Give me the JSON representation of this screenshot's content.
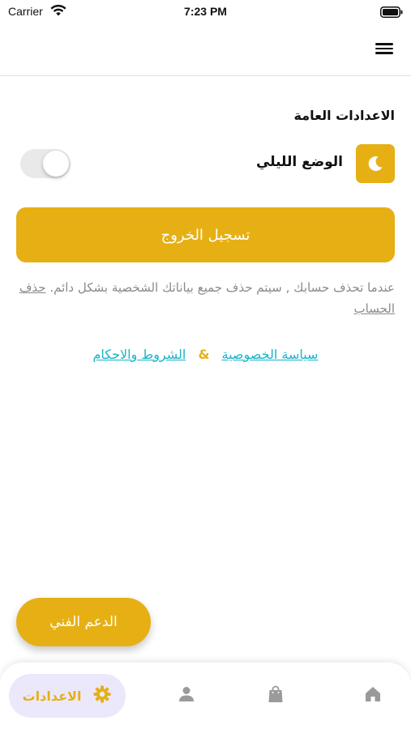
{
  "status_bar": {
    "carrier": "Carrier",
    "time": "7:23 PM"
  },
  "settings": {
    "section_title": "الاعدادات العامة",
    "dark_mode_label": "الوضع الليلي",
    "dark_mode_enabled": false,
    "logout_label": "تسجيل الخروج",
    "delete_note": "عندما تحذف حسابك , سيتم حذف جميع بياناتك الشخصية بشكل دائم.",
    "delete_link": "حذف الحساب",
    "privacy_link": "سياسة الخصوصية",
    "amp": "&",
    "terms_link": "الشروط والاحكام",
    "support_label": "الدعم الفني"
  },
  "bottom_nav": {
    "settings_label": "الاعدادات",
    "items": [
      "settings",
      "profile",
      "shop",
      "home"
    ]
  },
  "colors": {
    "accent": "#e6b015",
    "link": "#16b5c8",
    "nav_active_bg": "#ece8fb",
    "muted_text": "#8a8a8a"
  },
  "icons": {
    "header": "menu-icon",
    "dark_mode": "moon-icon",
    "nav": [
      "gear-icon",
      "person-icon",
      "shopping-bag-icon",
      "home-icon"
    ]
  }
}
